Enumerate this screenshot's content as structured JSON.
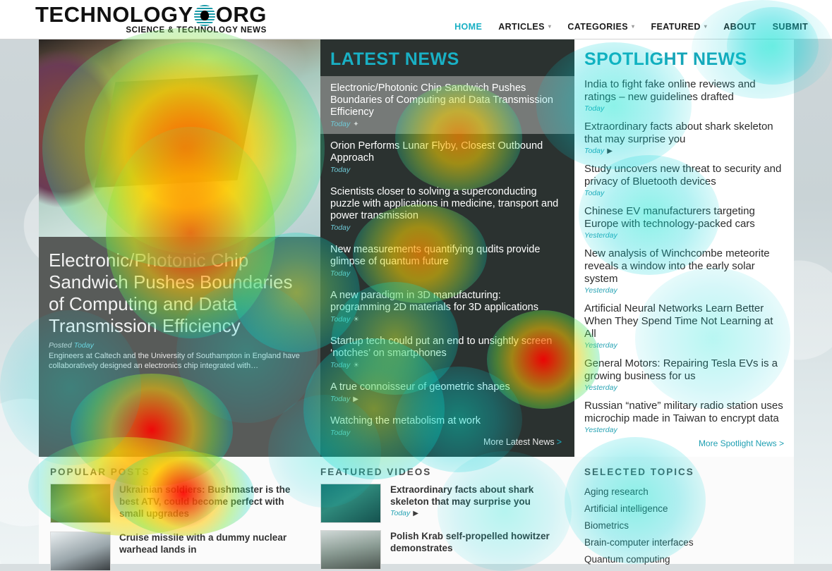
{
  "site": {
    "logo_main": "TECHNOLOGY",
    "logo_tld": "ORG",
    "logo_sub": "SCIENCE & TECHNOLOGY NEWS",
    "accent_color": "#19b0c4"
  },
  "nav": {
    "items": [
      {
        "label": "HOME",
        "caret": false,
        "active": true
      },
      {
        "label": "ARTICLES",
        "caret": true,
        "active": false
      },
      {
        "label": "CATEGORIES",
        "caret": true,
        "active": false
      },
      {
        "label": "FEATURED",
        "caret": true,
        "active": false
      },
      {
        "label": "ABOUT",
        "caret": false,
        "active": false
      },
      {
        "label": "SUBMIT",
        "caret": false,
        "active": false
      }
    ],
    "caret_glyph": "▾"
  },
  "hero": {
    "title": "Electronic/Photonic Chip Sandwich Pushes Boundaries of Computing and Data Transmission Efficiency",
    "posted_label": "Posted",
    "posted_when": "Today",
    "excerpt": "Engineers at Caltech and the University of Southampton in England have collaboratively designed an electronics chip integrated with…"
  },
  "latest_news": {
    "heading": "LATEST NEWS",
    "more_label": "More Latest News",
    "more_glyph": ">",
    "items": [
      {
        "title": "Electronic/Photonic Chip Sandwich Pushes Boundaries of Computing and Data Transmission Efficiency",
        "meta": "Today",
        "icon": "",
        "highlight": true
      },
      {
        "title": "Orion Performs Lunar Flyby, Closest Outbound Approach",
        "meta": "Today",
        "icon": "",
        "highlight": false
      },
      {
        "title": "Scientists closer to solving a superconducting puzzle with applications in medicine, transport and power transmission",
        "meta": "Today",
        "icon": "",
        "highlight": false
      },
      {
        "title": "New measurements quantifying qudits provide glimpse of quantum future",
        "meta": "Today",
        "icon": "",
        "highlight": false
      },
      {
        "title": "A new paradigm in 3D manufacturing: programming 2D materials for 3D applications",
        "meta": "Today",
        "icon": "☀",
        "highlight": false
      },
      {
        "title": "Startup tech could put an end to unsightly screen ‘notches’ on smartphones",
        "meta": "Today",
        "icon": "☀",
        "highlight": false
      },
      {
        "title": "A true connoisseur of geometric shapes",
        "meta": "Today",
        "icon": "▶",
        "highlight": false
      },
      {
        "title": "Watching the metabolism at work",
        "meta": "Today",
        "icon": "",
        "highlight": false
      }
    ]
  },
  "spotlight_news": {
    "heading": "SPOTLIGHT NEWS",
    "more_label": "More Spotlight News >",
    "items": [
      {
        "title": "India to fight fake online reviews and ratings – new guidelines drafted",
        "meta": "Today",
        "icon": ""
      },
      {
        "title": "Extraordinary facts about shark skeleton that may surprise you",
        "meta": "Today",
        "icon": "▶"
      },
      {
        "title": "Study uncovers new threat to security and privacy of Bluetooth devices",
        "meta": "Today",
        "icon": ""
      },
      {
        "title": "Chinese EV manufacturers targeting Europe with technology-packed cars",
        "meta": "Yesterday",
        "icon": ""
      },
      {
        "title": "New analysis of Winchcombe meteorite reveals a window into the early solar system",
        "meta": "Yesterday",
        "icon": ""
      },
      {
        "title": "Artificial Neural Networks Learn Better When They Spend Time Not Learning at All",
        "meta": "Yesterday",
        "icon": ""
      },
      {
        "title": "General Motors: Repairing Tesla EVs is a growing business for us",
        "meta": "Yesterday",
        "icon": ""
      },
      {
        "title": "Russian “native” military radio station uses microchip made in Taiwan to encrypt data",
        "meta": "Yesterday",
        "icon": ""
      }
    ]
  },
  "popular_posts": {
    "heading": "POPULAR POSTS",
    "items": [
      {
        "title": "Ukrainian soldiers: Bushmaster is the best ATV, could become perfect with small upgrades"
      },
      {
        "title": "Cruise missile with a dummy nuclear warhead lands in"
      }
    ]
  },
  "featured_videos": {
    "heading": "FEATURED VIDEOS",
    "items": [
      {
        "title": "Extraordinary facts about shark skeleton that may surprise you",
        "meta": "Today",
        "icon": "▶"
      },
      {
        "title": "Polish Krab self-propelled howitzer demonstrates",
        "meta": "",
        "icon": ""
      }
    ]
  },
  "selected_topics": {
    "heading": "SELECTED TOPICS",
    "items": [
      {
        "label": "Aging research"
      },
      {
        "label": "Artificial intelligence"
      },
      {
        "label": "Biometrics"
      },
      {
        "label": "Brain-computer interfaces"
      },
      {
        "label": "Quantum computing"
      }
    ]
  }
}
